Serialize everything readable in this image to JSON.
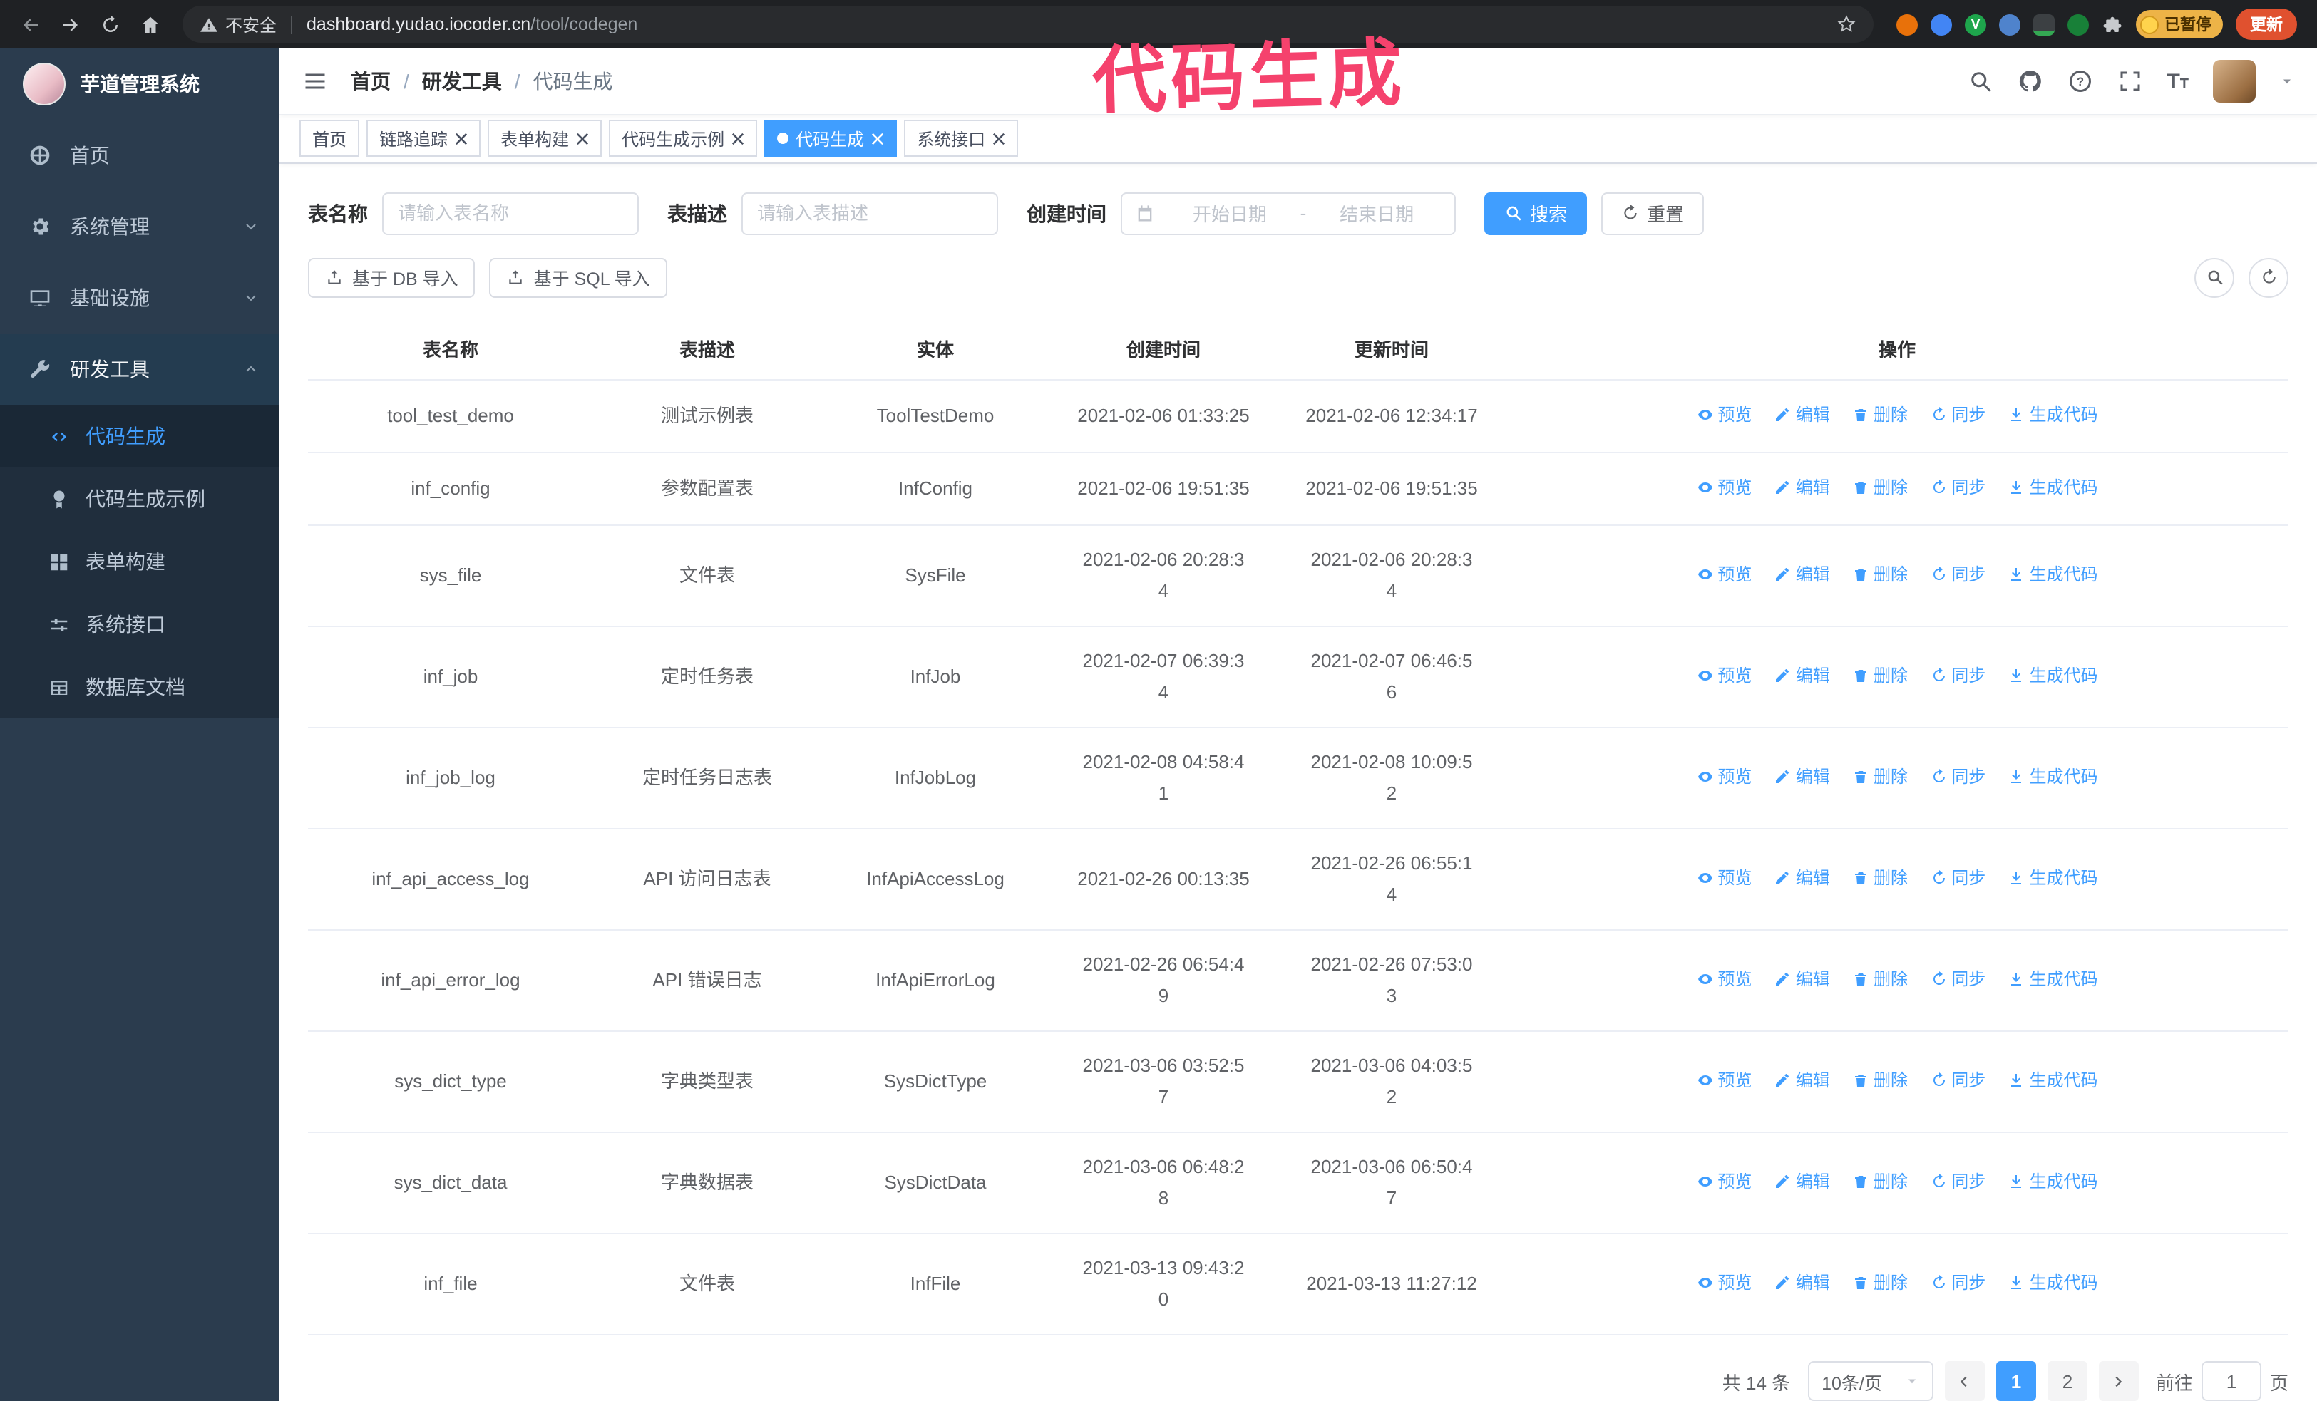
{
  "browser": {
    "security_label": "不安全",
    "url_domain": "dashboard.yudao.iocoder.cn",
    "url_path": "/tool/codegen",
    "paused_badge": "已暂停",
    "update_button": "更新"
  },
  "annotation": {
    "text": "代码生成",
    "color": "#f5426d"
  },
  "sidebar": {
    "logo_title": "芋道管理系统",
    "items": [
      "首页",
      "系统管理",
      "基础设施",
      "研发工具"
    ],
    "subitems": [
      "代码生成",
      "代码生成示例",
      "表单构建",
      "系统接口",
      "数据库文档"
    ],
    "active_subitem": "代码生成"
  },
  "header": {
    "breadcrumb": [
      "首页",
      "研发工具",
      "代码生成"
    ],
    "separator": "/"
  },
  "tabs": [
    {
      "label": "首页",
      "closable": false,
      "active": false
    },
    {
      "label": "链路追踪",
      "closable": true,
      "active": false
    },
    {
      "label": "表单构建",
      "closable": true,
      "active": false
    },
    {
      "label": "代码生成示例",
      "closable": true,
      "active": false
    },
    {
      "label": "代码生成",
      "closable": true,
      "active": true
    },
    {
      "label": "系统接口",
      "closable": true,
      "active": false
    }
  ],
  "filters": {
    "table_name_label": "表名称",
    "table_name_placeholder": "请输入表名称",
    "table_desc_label": "表描述",
    "table_desc_placeholder": "请输入表描述",
    "create_time_label": "创建时间",
    "date_start_placeholder": "开始日期",
    "date_separator": "-",
    "date_end_placeholder": "结束日期",
    "search_button": "搜索",
    "reset_button": "重置"
  },
  "toolbar": {
    "import_db": "基于 DB 导入",
    "import_sql": "基于 SQL 导入"
  },
  "table": {
    "columns": [
      "表名称",
      "表描述",
      "实体",
      "创建时间",
      "更新时间",
      "操作"
    ],
    "actions": [
      "预览",
      "编辑",
      "删除",
      "同步",
      "生成代码"
    ],
    "rows": [
      {
        "name": "tool_test_demo",
        "desc": "测试示例表",
        "entity": "ToolTestDemo",
        "created": "2021-02-06 01:33:25",
        "updated": "2021-02-06 12:34:17"
      },
      {
        "name": "inf_config",
        "desc": "参数配置表",
        "entity": "InfConfig",
        "created": "2021-02-06 19:51:35",
        "updated": "2021-02-06 19:51:35"
      },
      {
        "name": "sys_file",
        "desc": "文件表",
        "entity": "SysFile",
        "created": "2021-02-06 20:28:3\n4",
        "updated": "2021-02-06 20:28:3\n4"
      },
      {
        "name": "inf_job",
        "desc": "定时任务表",
        "entity": "InfJob",
        "created": "2021-02-07 06:39:3\n4",
        "updated": "2021-02-07 06:46:5\n6"
      },
      {
        "name": "inf_job_log",
        "desc": "定时任务日志表",
        "entity": "InfJobLog",
        "created": "2021-02-08 04:58:4\n1",
        "updated": "2021-02-08 10:09:5\n2"
      },
      {
        "name": "inf_api_access_log",
        "desc": "API 访问日志表",
        "entity": "InfApiAccessLog",
        "created": "2021-02-26 00:13:35",
        "updated": "2021-02-26 06:55:1\n4"
      },
      {
        "name": "inf_api_error_log",
        "desc": "API 错误日志",
        "entity": "InfApiErrorLog",
        "created": "2021-02-26 06:54:4\n9",
        "updated": "2021-02-26 07:53:0\n3"
      },
      {
        "name": "sys_dict_type",
        "desc": "字典类型表",
        "entity": "SysDictType",
        "created": "2021-03-06 03:52:5\n7",
        "updated": "2021-03-06 04:03:5\n2"
      },
      {
        "name": "sys_dict_data",
        "desc": "字典数据表",
        "entity": "SysDictData",
        "created": "2021-03-06 06:48:2\n8",
        "updated": "2021-03-06 06:50:4\n7"
      },
      {
        "name": "inf_file",
        "desc": "文件表",
        "entity": "InfFile",
        "created": "2021-03-13 09:43:2\n0",
        "updated": "2021-03-13 11:27:12"
      }
    ]
  },
  "pagination": {
    "total": "共 14 条",
    "page_size": "10条/页",
    "pages": [
      "1",
      "2"
    ],
    "active_page": "1",
    "goto_prefix": "前往",
    "goto_value": "1",
    "goto_suffix": "页"
  },
  "colors": {
    "accent": "#409eff",
    "sidebar_bg": "#2b3c4e",
    "annotation": "#f5426d"
  }
}
